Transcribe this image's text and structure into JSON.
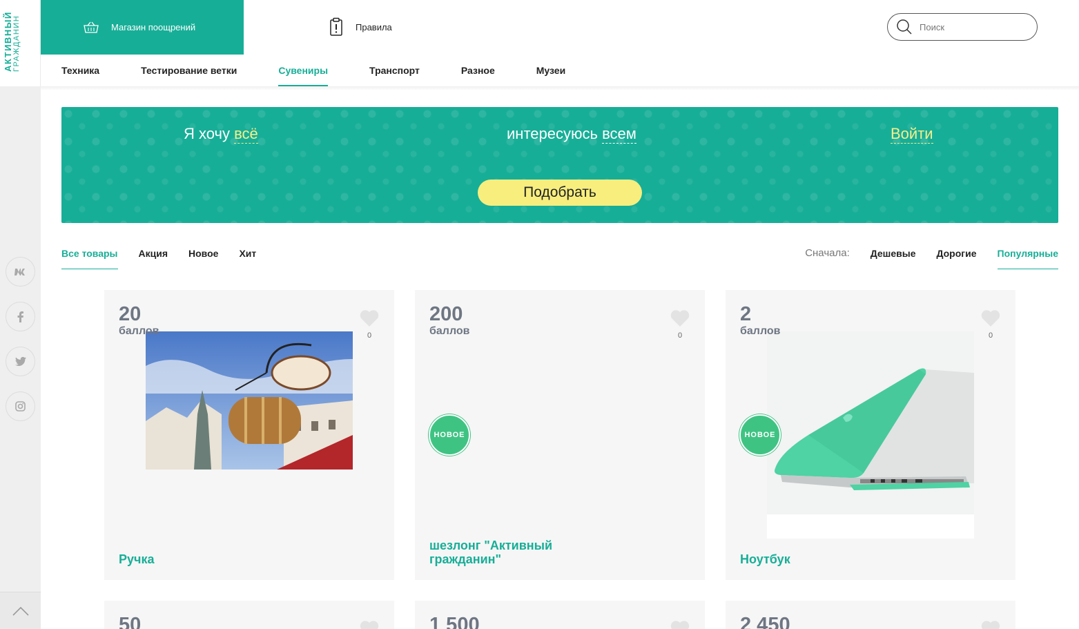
{
  "brand": {
    "line1": "АКТИВНЫЙ",
    "line2": "ГРАЖДАНИН"
  },
  "header": {
    "shop_label": "Магазин поощрений",
    "rules_label": "Правила",
    "search_placeholder": "Поиск"
  },
  "categories": [
    "Техника",
    "Тестирование ветки",
    "Сувениры",
    "Транспорт",
    "Разное",
    "Музеи"
  ],
  "active_category": "Сувениры",
  "social": [
    "vk-icon",
    "facebook-icon",
    "twitter-icon",
    "instagram-icon"
  ],
  "banner": {
    "want_prefix": "Я хочу",
    "want_value": "всё",
    "interest_prefix": "интересуюсь",
    "interest_value": "всем",
    "login_label": "Войти",
    "pick_label": "Подобрать"
  },
  "filters": [
    "Все товары",
    "Акция",
    "Новое",
    "Хит"
  ],
  "active_filter": "Все товары",
  "sort": {
    "label": "Сначала:",
    "options": [
      "Дешевые",
      "Дорогие",
      "Популярные"
    ],
    "active": "Популярные"
  },
  "products": [
    {
      "price": "20",
      "unit": "баллов",
      "likes": "0",
      "name": "Ручка",
      "badge": "",
      "image": "trdlo-photo"
    },
    {
      "price": "200",
      "unit": "баллов",
      "likes": "0",
      "name": "шезлонг \"Активный гражданин\"",
      "badge": "НОВОЕ",
      "image": ""
    },
    {
      "price": "2",
      "unit": "баллов",
      "likes": "0",
      "name": "Ноутбук",
      "badge": "НОВОЕ",
      "image": "laptop-photo"
    },
    {
      "price": "50"
    },
    {
      "price": "1 500"
    },
    {
      "price": "2 450"
    }
  ],
  "colors": {
    "accent": "#17ae97",
    "badge": "#3fc383",
    "yellow": "#f7ee7e",
    "card_bg": "#f6f6f6"
  }
}
